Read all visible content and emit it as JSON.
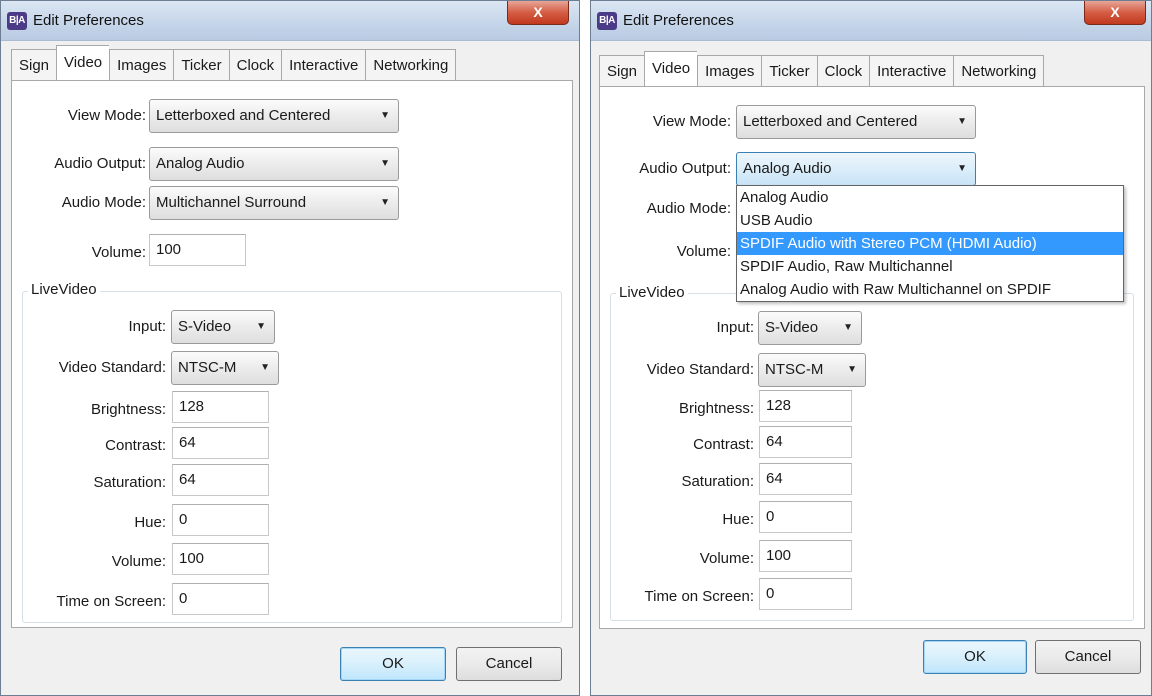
{
  "window": {
    "title": "Edit Preferences",
    "app_icon_text": "B|A",
    "close_glyph": "X"
  },
  "tabs": [
    "Sign",
    "Video",
    "Images",
    "Ticker",
    "Clock",
    "Interactive",
    "Networking"
  ],
  "active_tab": "Video",
  "video": {
    "view_mode_label": "View Mode:",
    "view_mode_value": "Letterboxed and Centered",
    "audio_output_label": "Audio Output:",
    "audio_output_value": "Analog Audio",
    "audio_mode_label": "Audio Mode:",
    "audio_mode_value": "Multichannel Surround",
    "volume_label": "Volume:",
    "volume_value": "100"
  },
  "livevideo": {
    "legend": "LiveVideo",
    "input_label": "Input:",
    "input_value": "S-Video",
    "standard_label": "Video Standard:",
    "standard_value": "NTSC-M",
    "brightness_label": "Brightness:",
    "brightness_value": "128",
    "contrast_label": "Contrast:",
    "contrast_value": "64",
    "saturation_label": "Saturation:",
    "saturation_value": "64",
    "hue_label": "Hue:",
    "hue_value": "0",
    "volume_label": "Volume:",
    "volume_value": "100",
    "time_label": "Time on Screen:",
    "time_value": "0"
  },
  "buttons": {
    "ok": "OK",
    "cancel": "Cancel"
  },
  "audio_output_options": [
    "Analog Audio",
    "USB Audio",
    "SPDIF Audio with Stereo PCM (HDMI Audio)",
    "SPDIF Audio, Raw Multichannel",
    "Analog Audio with Raw Multichannel on SPDIF"
  ],
  "highlighted_option_index": 2,
  "colors": {
    "selection": "#3399ff",
    "close_button": "#c1391e",
    "app_icon": "#4b3a85"
  }
}
